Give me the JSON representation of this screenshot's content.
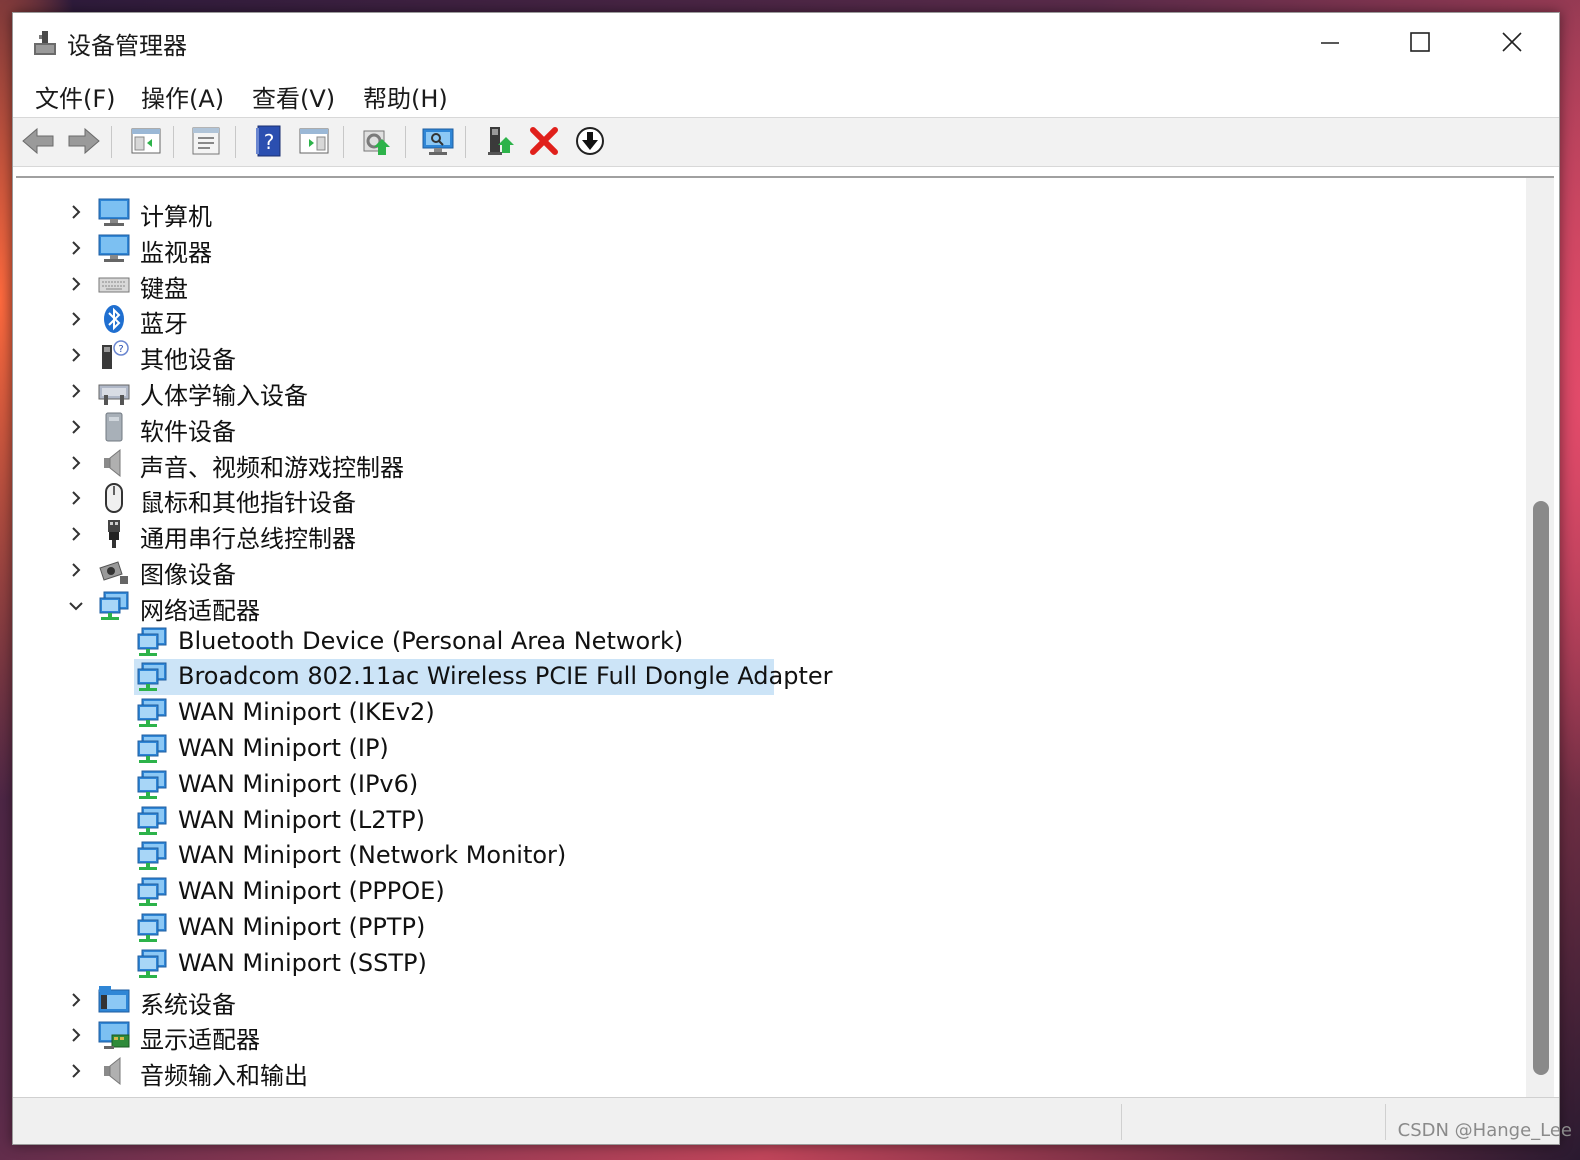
{
  "window": {
    "title": "设备管理器",
    "minimize_label": "minimize",
    "maximize_label": "maximize",
    "close_label": "close"
  },
  "menu": {
    "items": [
      {
        "label": "文件(F)"
      },
      {
        "label": "操作(A)"
      },
      {
        "label": "查看(V)"
      },
      {
        "label": "帮助(H)"
      }
    ]
  },
  "toolbar": {
    "buttons": [
      {
        "icon": "back-arrow-icon"
      },
      {
        "icon": "forward-arrow-icon"
      },
      {
        "icon": "show-hide-console-tree-icon"
      },
      {
        "icon": "properties-icon"
      },
      {
        "icon": "help-icon"
      },
      {
        "icon": "show-action-pane-icon"
      },
      {
        "icon": "update-driver-icon"
      },
      {
        "icon": "scan-hardware-icon"
      },
      {
        "icon": "enable-device-icon"
      },
      {
        "icon": "uninstall-device-icon"
      },
      {
        "icon": "download-driver-icon"
      }
    ]
  },
  "tree": {
    "categories": [
      {
        "label": "计算机",
        "icon": "computer-icon",
        "expanded": false
      },
      {
        "label": "监视器",
        "icon": "monitor-icon",
        "expanded": false
      },
      {
        "label": "键盘",
        "icon": "keyboard-icon",
        "expanded": false
      },
      {
        "label": "蓝牙",
        "icon": "bluetooth-icon",
        "expanded": false
      },
      {
        "label": "其他设备",
        "icon": "unknown-device-icon",
        "expanded": false
      },
      {
        "label": "人体学输入设备",
        "icon": "hid-icon",
        "expanded": false
      },
      {
        "label": "软件设备",
        "icon": "software-device-icon",
        "expanded": false
      },
      {
        "label": "声音、视频和游戏控制器",
        "icon": "speaker-icon",
        "expanded": false
      },
      {
        "label": "鼠标和其他指针设备",
        "icon": "mouse-icon",
        "expanded": false
      },
      {
        "label": "通用串行总线控制器",
        "icon": "usb-icon",
        "expanded": false
      },
      {
        "label": "图像设备",
        "icon": "camera-icon",
        "expanded": false
      },
      {
        "label": "网络适配器",
        "icon": "network-adapter-icon",
        "expanded": true
      },
      {
        "label": "系统设备",
        "icon": "system-device-icon",
        "expanded": false
      },
      {
        "label": "显示适配器",
        "icon": "display-adapter-icon",
        "expanded": false
      },
      {
        "label": "音频输入和输出",
        "icon": "audio-io-icon",
        "expanded": false
      }
    ],
    "network_adapters": [
      {
        "label": "Bluetooth Device (Personal Area Network)",
        "selected": false
      },
      {
        "label": "Broadcom 802.11ac Wireless PCIE Full Dongle Adapter",
        "selected": true
      },
      {
        "label": "WAN Miniport (IKEv2)",
        "selected": false
      },
      {
        "label": "WAN Miniport (IP)",
        "selected": false
      },
      {
        "label": "WAN Miniport (IPv6)",
        "selected": false
      },
      {
        "label": "WAN Miniport (L2TP)",
        "selected": false
      },
      {
        "label": "WAN Miniport (Network Monitor)",
        "selected": false
      },
      {
        "label": "WAN Miniport (PPPOE)",
        "selected": false
      },
      {
        "label": "WAN Miniport (PPTP)",
        "selected": false
      },
      {
        "label": "WAN Miniport (SSTP)",
        "selected": false
      }
    ]
  },
  "watermark": "CSDN @Hange_Lee",
  "colors": {
    "selection": "#cce4f7",
    "monitor_blue": "#2f86d6",
    "network_green": "#2db34a",
    "uninstall_red": "#e0201b",
    "help_blue": "#2b4fb0"
  }
}
